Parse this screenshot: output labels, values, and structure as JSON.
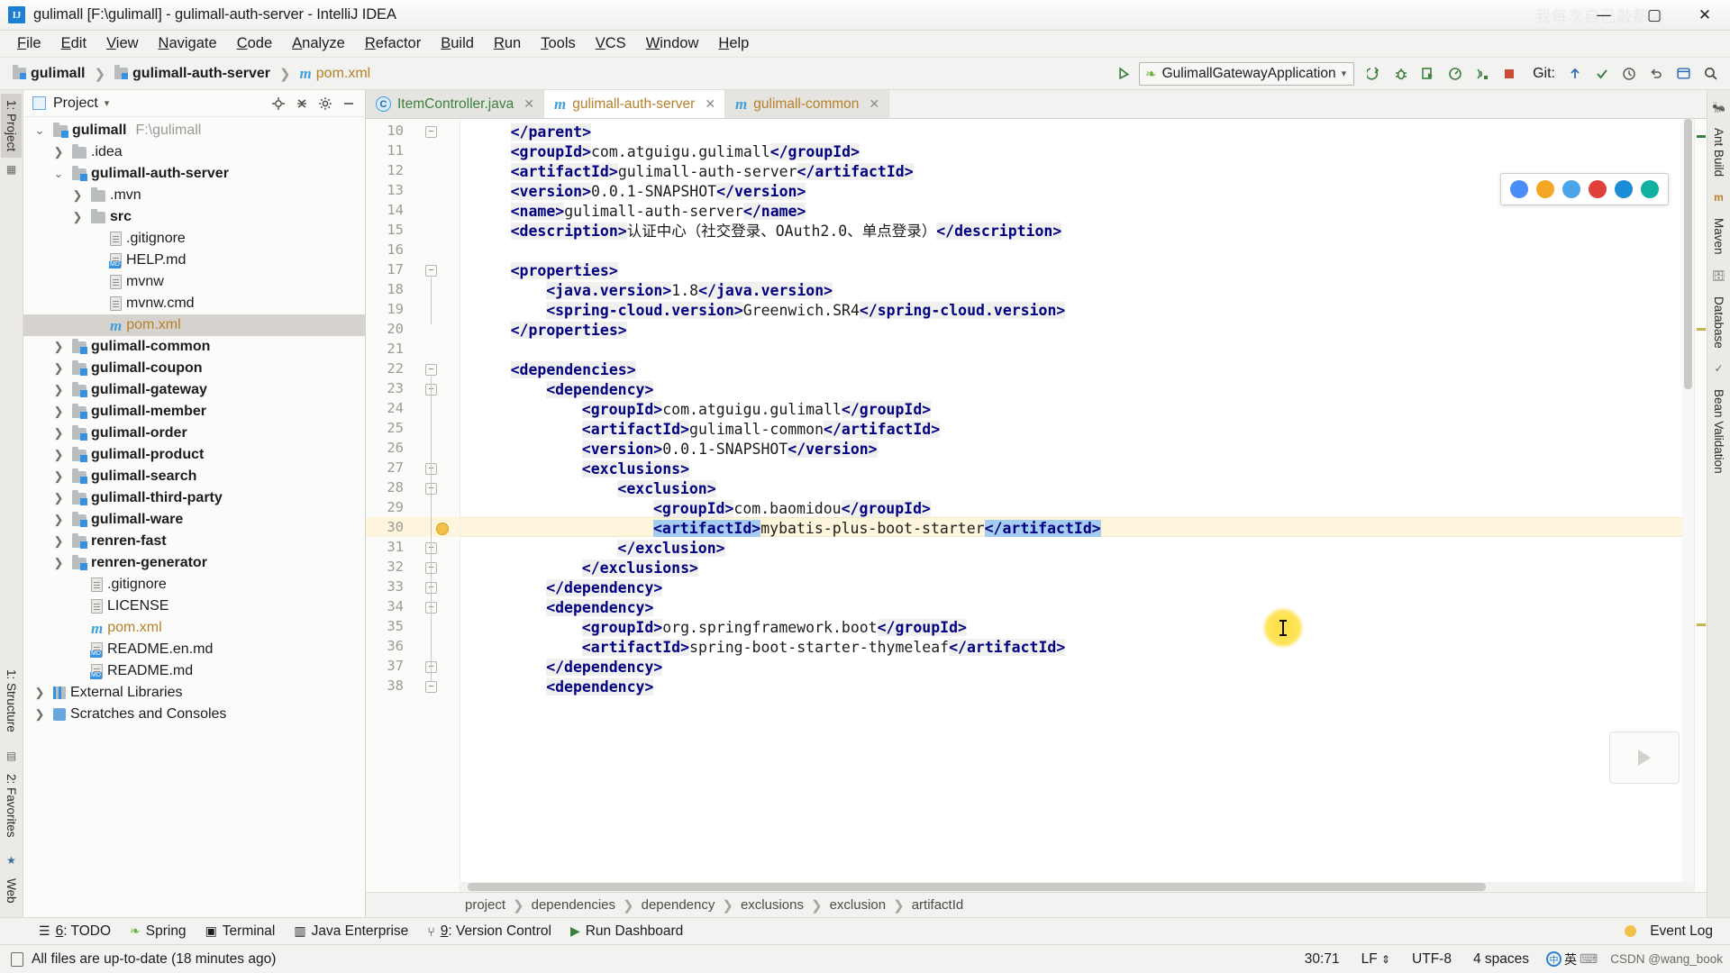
{
  "window": {
    "title": "gulimall [F:\\gulimall] - gulimall-auth-server - IntelliJ IDEA",
    "logo_letters": "IJ",
    "watermark": "我每次自己敲都容",
    "minimize": "—",
    "maximize": "▢",
    "close": "✕"
  },
  "menubar": {
    "items": [
      {
        "label": "File"
      },
      {
        "label": "Edit"
      },
      {
        "label": "View"
      },
      {
        "label": "Navigate"
      },
      {
        "label": "Code"
      },
      {
        "label": "Analyze"
      },
      {
        "label": "Refactor"
      },
      {
        "label": "Build"
      },
      {
        "label": "Run"
      },
      {
        "label": "Tools"
      },
      {
        "label": "VCS"
      },
      {
        "label": "Window"
      },
      {
        "label": "Help"
      }
    ]
  },
  "navbar": {
    "breadcrumbs": [
      {
        "label": "gulimall",
        "icon": "module-icon"
      },
      {
        "label": "gulimall-auth-server",
        "icon": "module-icon"
      },
      {
        "label": "pom.xml",
        "icon": "maven-m-icon"
      }
    ],
    "run_config": "GulimallGatewayApplication",
    "run_config_icon": "spring-leaf-icon",
    "git_label": "Git:",
    "toolbar_icons": [
      "build-icon",
      "debug-icon",
      "run-with-coverage-icon",
      "profiler-icon",
      "services-icon",
      "stop-icon"
    ],
    "git_icons": [
      "update-icon",
      "commit-icon",
      "history-icon",
      "rollback-icon"
    ],
    "right_icons": [
      "settings-icon",
      "search-everywhere-icon"
    ]
  },
  "left_rail": {
    "tabs": [
      {
        "label": "1: Project",
        "active": true
      }
    ]
  },
  "left_rail_bottom": {
    "tabs": [
      {
        "label": "1: Structure"
      },
      {
        "label": "2: Favorites"
      },
      {
        "label": "Web"
      }
    ]
  },
  "right_rail": {
    "tabs": [
      {
        "label": "Ant Build"
      },
      {
        "label": "Maven"
      },
      {
        "label": "Database"
      },
      {
        "label": "Bean Validation"
      }
    ]
  },
  "project_panel": {
    "title": "Project",
    "actions": [
      "locate-icon",
      "collapse-all-icon",
      "gear-icon",
      "hide-icon"
    ],
    "tree": [
      {
        "label": "gulimall",
        "suffix": "F:\\gulimall",
        "depth": 0,
        "twisty": "open",
        "icon": "module-folder",
        "bold": true
      },
      {
        "label": ".idea",
        "depth": 1,
        "twisty": "closed",
        "icon": "folder"
      },
      {
        "label": "gulimall-auth-server",
        "depth": 1,
        "twisty": "open",
        "icon": "module-folder",
        "bold": true
      },
      {
        "label": ".mvn",
        "depth": 2,
        "twisty": "closed",
        "icon": "folder"
      },
      {
        "label": "src",
        "depth": 2,
        "twisty": "closed",
        "icon": "folder",
        "bold": true
      },
      {
        "label": ".gitignore",
        "depth": 3,
        "twisty": "none",
        "icon": "file"
      },
      {
        "label": "HELP.md",
        "depth": 3,
        "twisty": "none",
        "icon": "md-file"
      },
      {
        "label": "mvnw",
        "depth": 3,
        "twisty": "none",
        "icon": "file"
      },
      {
        "label": "mvnw.cmd",
        "depth": 3,
        "twisty": "none",
        "icon": "file"
      },
      {
        "label": "pom.xml",
        "depth": 3,
        "twisty": "none",
        "icon": "maven-file",
        "selected": true,
        "orange": true
      },
      {
        "label": "gulimall-common",
        "depth": 1,
        "twisty": "closed",
        "icon": "module-folder",
        "bold": true
      },
      {
        "label": "gulimall-coupon",
        "depth": 1,
        "twisty": "closed",
        "icon": "module-folder",
        "bold": true
      },
      {
        "label": "gulimall-gateway",
        "depth": 1,
        "twisty": "closed",
        "icon": "module-folder",
        "bold": true
      },
      {
        "label": "gulimall-member",
        "depth": 1,
        "twisty": "closed",
        "icon": "module-folder",
        "bold": true
      },
      {
        "label": "gulimall-order",
        "depth": 1,
        "twisty": "closed",
        "icon": "module-folder",
        "bold": true
      },
      {
        "label": "gulimall-product",
        "depth": 1,
        "twisty": "closed",
        "icon": "module-folder",
        "bold": true
      },
      {
        "label": "gulimall-search",
        "depth": 1,
        "twisty": "closed",
        "icon": "module-folder",
        "bold": true
      },
      {
        "label": "gulimall-third-party",
        "depth": 1,
        "twisty": "closed",
        "icon": "module-folder",
        "bold": true
      },
      {
        "label": "gulimall-ware",
        "depth": 1,
        "twisty": "closed",
        "icon": "module-folder",
        "bold": true
      },
      {
        "label": "renren-fast",
        "depth": 1,
        "twisty": "closed",
        "icon": "module-folder",
        "bold": true
      },
      {
        "label": "renren-generator",
        "depth": 1,
        "twisty": "closed",
        "icon": "module-folder",
        "bold": true
      },
      {
        "label": ".gitignore",
        "depth": 2,
        "twisty": "none",
        "icon": "file"
      },
      {
        "label": "LICENSE",
        "depth": 2,
        "twisty": "none",
        "icon": "file"
      },
      {
        "label": "pom.xml",
        "depth": 2,
        "twisty": "none",
        "icon": "maven-file",
        "orange": true
      },
      {
        "label": "README.en.md",
        "depth": 2,
        "twisty": "none",
        "icon": "md-file"
      },
      {
        "label": "README.md",
        "depth": 2,
        "twisty": "none",
        "icon": "md-file"
      },
      {
        "label": "External Libraries",
        "depth": 0,
        "twisty": "closed",
        "icon": "library",
        "bold": false
      },
      {
        "label": "Scratches and Consoles",
        "depth": 0,
        "twisty": "closed",
        "icon": "scratch",
        "bold": false
      }
    ]
  },
  "editor": {
    "tabs": [
      {
        "label": "ItemController.java",
        "icon": "java-class-icon",
        "active": false,
        "closable": true,
        "color": "green"
      },
      {
        "label": "gulimall-auth-server",
        "icon": "maven-m-icon",
        "active": true,
        "closable": true,
        "color": "orange"
      },
      {
        "label": "gulimall-common",
        "icon": "maven-m-icon",
        "active": false,
        "closable": true,
        "color": "orange"
      }
    ],
    "first_line_number": 10,
    "highlighted_line": 30,
    "lines": [
      {
        "n": 10,
        "indent": 1,
        "fold": "end",
        "tokens": [
          {
            "t": "</parent>",
            "c": "tag"
          }
        ]
      },
      {
        "n": 11,
        "indent": 1,
        "tokens": [
          {
            "t": "<groupId>",
            "c": "tag"
          },
          {
            "t": "com.atguigu.gulimall",
            "c": "txt"
          },
          {
            "t": "</groupId>",
            "c": "tag"
          }
        ]
      },
      {
        "n": 12,
        "indent": 1,
        "tokens": [
          {
            "t": "<artifactId>",
            "c": "tag"
          },
          {
            "t": "gulimall-auth-server",
            "c": "txt"
          },
          {
            "t": "</artifactId>",
            "c": "tag"
          }
        ]
      },
      {
        "n": 13,
        "indent": 1,
        "tokens": [
          {
            "t": "<version>",
            "c": "tag"
          },
          {
            "t": "0.0.1-SNAPSHOT",
            "c": "txt"
          },
          {
            "t": "</version>",
            "c": "tag"
          }
        ]
      },
      {
        "n": 14,
        "indent": 1,
        "tokens": [
          {
            "t": "<name>",
            "c": "tag"
          },
          {
            "t": "gulimall-auth-server",
            "c": "txt"
          },
          {
            "t": "</name>",
            "c": "tag"
          }
        ]
      },
      {
        "n": 15,
        "indent": 1,
        "tokens": [
          {
            "t": "<description>",
            "c": "tag"
          },
          {
            "t": "认证中心（社交登录、OAuth2.0、单点登录）",
            "c": "txt"
          },
          {
            "t": "</description>",
            "c": "tag"
          }
        ]
      },
      {
        "n": 16,
        "indent": 1,
        "tokens": []
      },
      {
        "n": 17,
        "indent": 1,
        "fold": "start",
        "tokens": [
          {
            "t": "<properties>",
            "c": "tag"
          }
        ]
      },
      {
        "n": 18,
        "indent": 2,
        "tokens": [
          {
            "t": "<java.version>",
            "c": "tag"
          },
          {
            "t": "1.8",
            "c": "txt"
          },
          {
            "t": "</java.version>",
            "c": "tag"
          }
        ]
      },
      {
        "n": 19,
        "indent": 2,
        "tokens": [
          {
            "t": "<spring-cloud.version>",
            "c": "tag"
          },
          {
            "t": "Greenwich.SR4",
            "c": "txt"
          },
          {
            "t": "</spring-cloud.version>",
            "c": "tag"
          }
        ]
      },
      {
        "n": 20,
        "indent": 1,
        "tokens": [
          {
            "t": "</properties>",
            "c": "tag"
          }
        ]
      },
      {
        "n": 21,
        "indent": 1,
        "tokens": []
      },
      {
        "n": 22,
        "indent": 1,
        "fold": "start",
        "tokens": [
          {
            "t": "<dependencies>",
            "c": "tag"
          }
        ]
      },
      {
        "n": 23,
        "indent": 2,
        "fold": "start",
        "tokens": [
          {
            "t": "<dependency>",
            "c": "tag"
          }
        ]
      },
      {
        "n": 24,
        "indent": 3,
        "tokens": [
          {
            "t": "<groupId>",
            "c": "tag"
          },
          {
            "t": "com.atguigu.gulimall",
            "c": "txt"
          },
          {
            "t": "</groupId>",
            "c": "tag"
          }
        ]
      },
      {
        "n": 25,
        "indent": 3,
        "tokens": [
          {
            "t": "<artifactId>",
            "c": "tag"
          },
          {
            "t": "gulimall-common",
            "c": "txt"
          },
          {
            "t": "</artifactId>",
            "c": "tag"
          }
        ]
      },
      {
        "n": 26,
        "indent": 3,
        "tokens": [
          {
            "t": "<version>",
            "c": "tag"
          },
          {
            "t": "0.0.1-SNAPSHOT",
            "c": "txt"
          },
          {
            "t": "</version>",
            "c": "tag"
          }
        ]
      },
      {
        "n": 27,
        "indent": 3,
        "fold": "start",
        "tokens": [
          {
            "t": "<exclusions>",
            "c": "tag"
          }
        ]
      },
      {
        "n": 28,
        "indent": 4,
        "fold": "start",
        "tokens": [
          {
            "t": "<exclusion>",
            "c": "tag"
          }
        ]
      },
      {
        "n": 29,
        "indent": 5,
        "tokens": [
          {
            "t": "<groupId>",
            "c": "tag"
          },
          {
            "t": "com.baomidou",
            "c": "txt"
          },
          {
            "t": "</groupId>",
            "c": "tag"
          }
        ]
      },
      {
        "n": 30,
        "indent": 5,
        "bulb": true,
        "tokens": [
          {
            "t": "<artifactId>",
            "c": "tag-sel"
          },
          {
            "t": "mybatis-plus-boot-starter",
            "c": "txt"
          },
          {
            "t": "</artifactId>",
            "c": "tag-sel"
          }
        ]
      },
      {
        "n": 31,
        "indent": 4,
        "fold": "end",
        "tokens": [
          {
            "t": "</exclusion>",
            "c": "tag"
          }
        ]
      },
      {
        "n": 32,
        "indent": 3,
        "fold": "end",
        "tokens": [
          {
            "t": "</exclusions>",
            "c": "tag"
          }
        ]
      },
      {
        "n": 33,
        "indent": 2,
        "fold": "end",
        "tokens": [
          {
            "t": "</dependency>",
            "c": "tag"
          }
        ]
      },
      {
        "n": 34,
        "indent": 2,
        "fold": "start",
        "tokens": [
          {
            "t": "<dependency>",
            "c": "tag"
          }
        ]
      },
      {
        "n": 35,
        "indent": 3,
        "tokens": [
          {
            "t": "<groupId>",
            "c": "tag"
          },
          {
            "t": "org.springframework.boot",
            "c": "txt"
          },
          {
            "t": "</groupId>",
            "c": "tag"
          }
        ]
      },
      {
        "n": 36,
        "indent": 3,
        "tokens": [
          {
            "t": "<artifactId>",
            "c": "tag"
          },
          {
            "t": "spring-boot-starter-thymeleaf",
            "c": "txt"
          },
          {
            "t": "</artifactId>",
            "c": "tag"
          }
        ]
      },
      {
        "n": 37,
        "indent": 2,
        "fold": "end",
        "tokens": [
          {
            "t": "</dependency>",
            "c": "tag"
          }
        ]
      },
      {
        "n": 38,
        "indent": 2,
        "fold": "start",
        "tokens": [
          {
            "t": "<dependency>",
            "c": "tag"
          }
        ]
      }
    ],
    "breadcrumbs": [
      "project",
      "dependencies",
      "dependency",
      "exclusions",
      "exclusion",
      "artifactId"
    ]
  },
  "float_toolbar": {
    "icons": [
      "chrome-icon",
      "firefox-icon",
      "safari-icon",
      "opera-icon",
      "explorer-icon",
      "edge-icon"
    ],
    "colors": [
      "#4a8df6",
      "#f5a623",
      "#4aa6e8",
      "#e0403a",
      "#1b8dd4",
      "#12b0a0"
    ]
  },
  "tool_windows": {
    "buttons": [
      {
        "label": "6: TODO",
        "icon": "todo-icon",
        "mnemonic": "6"
      },
      {
        "label": "Spring",
        "icon": "spring-leaf-icon"
      },
      {
        "label": "Terminal",
        "icon": "terminal-icon"
      },
      {
        "label": "Java Enterprise",
        "icon": "java-ee-icon"
      },
      {
        "label": "9: Version Control",
        "icon": "vcs-icon",
        "mnemonic": "9"
      },
      {
        "label": "Run Dashboard",
        "icon": "run-dashboard-icon"
      }
    ],
    "event_log": "Event Log"
  },
  "statusbar": {
    "message": "All files are up-to-date (18 minutes ago)",
    "caret_position": "30:71",
    "line_separator": "LF",
    "encoding": "UTF-8",
    "indent": "4 spaces",
    "ime": "英",
    "watermark": "CSDN @wang_book"
  }
}
